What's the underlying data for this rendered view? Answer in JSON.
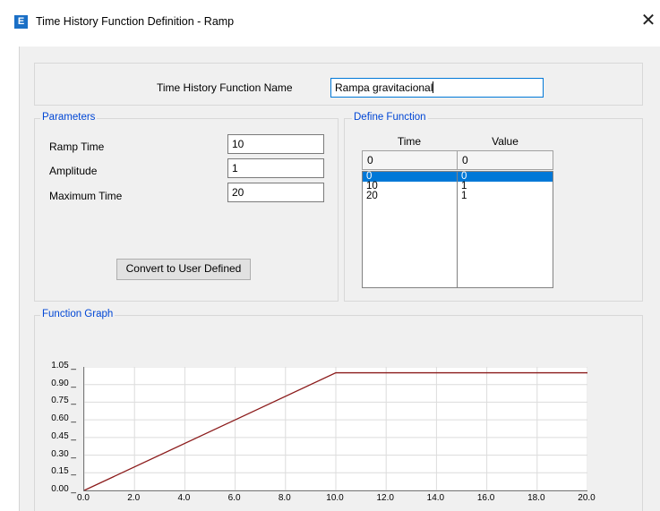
{
  "window": {
    "title": "Time History Function Definition  - Ramp",
    "app_icon_letter": "E",
    "close_glyph": "✕"
  },
  "function_name": {
    "label": "Time History Function Name",
    "value": "Rampa gravitacional"
  },
  "parameters": {
    "legend": "Parameters",
    "ramp_time_label": "Ramp Time",
    "ramp_time_value": "10",
    "amplitude_label": "Amplitude",
    "amplitude_value": "1",
    "max_time_label": "Maximum Time",
    "max_time_value": "20",
    "convert_button": "Convert to User Defined"
  },
  "define_function": {
    "legend": "Define Function",
    "col_time": "Time",
    "col_value": "Value",
    "input_time": "0",
    "input_value": "0",
    "rows": [
      {
        "time": "0",
        "value": "0",
        "selected": true
      },
      {
        "time": "10",
        "value": "1",
        "selected": false
      },
      {
        "time": "20",
        "value": "1",
        "selected": false
      }
    ]
  },
  "graph": {
    "legend": "Function Graph",
    "y_ticks": [
      "1.05",
      "0.90",
      "0.75",
      "0.60",
      "0.45",
      "0.30",
      "0.15",
      "0.00"
    ],
    "x_ticks": [
      "0.0",
      "2.0",
      "4.0",
      "6.0",
      "8.0",
      "10.0",
      "12.0",
      "14.0",
      "16.0",
      "18.0",
      "20.0"
    ],
    "line_color": "#8b1a1a"
  },
  "chart_data": {
    "type": "line",
    "x": [
      0,
      10,
      20
    ],
    "series": [
      {
        "values": [
          0,
          1,
          1
        ]
      }
    ],
    "xlim": [
      0,
      20
    ],
    "ylim": [
      0,
      1.05
    ],
    "grid": true
  }
}
